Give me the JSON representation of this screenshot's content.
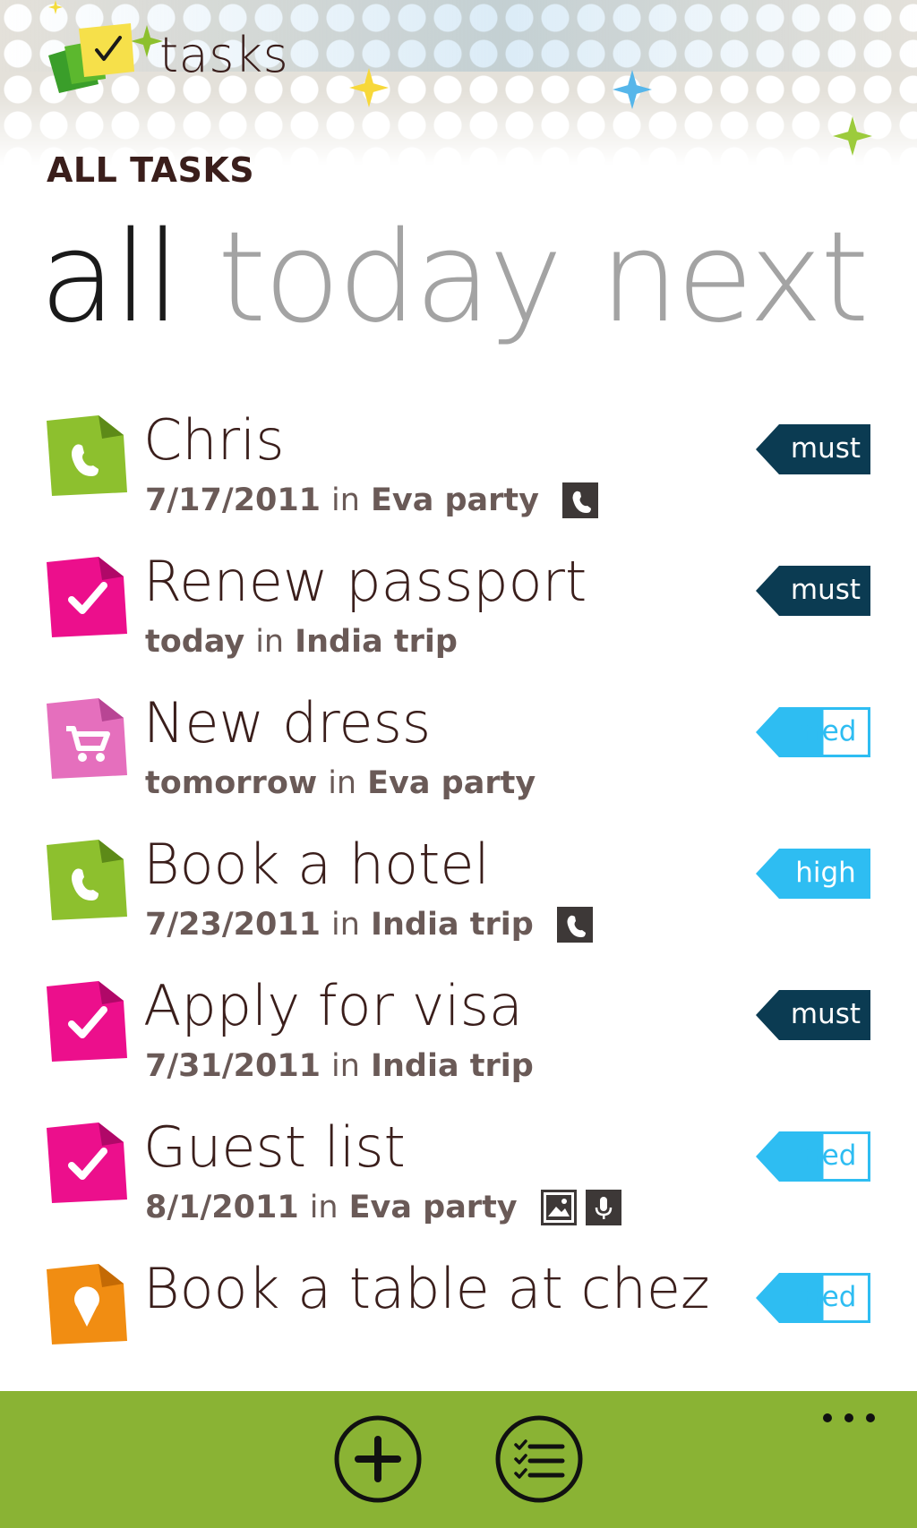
{
  "app": {
    "name": "tasks",
    "page_title": "ALL TASKS"
  },
  "pivot": {
    "items": [
      {
        "label": "all",
        "active": true
      },
      {
        "label": "today",
        "active": false
      },
      {
        "label": "next",
        "active": false
      }
    ]
  },
  "tasks": [
    {
      "title": "Chris",
      "due": "7/17/2011",
      "in_text": "in",
      "list": "Eva party",
      "icon": "phone-icon",
      "icon_color": "#8dc02e",
      "priority": "must",
      "attachments": [
        "phone-attachment-icon"
      ]
    },
    {
      "title": "Renew passport",
      "due": "today",
      "in_text": "in",
      "list": "India trip",
      "icon": "check-icon",
      "icon_color": "#ec0f8c",
      "priority": "must",
      "attachments": []
    },
    {
      "title": "New dress",
      "due": "tomorrow",
      "in_text": "in",
      "list": "Eva party",
      "icon": "cart-icon",
      "icon_color": "#e56fbd",
      "priority": "med",
      "attachments": []
    },
    {
      "title": "Book a hotel",
      "due": "7/23/2011",
      "in_text": "in",
      "list": "India trip",
      "icon": "phone-icon",
      "icon_color": "#8dc02e",
      "priority": "high",
      "attachments": [
        "phone-attachment-icon"
      ]
    },
    {
      "title": "Apply for visa",
      "due": "7/31/2011",
      "in_text": "in",
      "list": "India trip",
      "icon": "check-icon",
      "icon_color": "#ec0f8c",
      "priority": "must",
      "attachments": []
    },
    {
      "title": "Guest list",
      "due": "8/1/2011",
      "in_text": "in",
      "list": "Eva party",
      "icon": "check-icon",
      "icon_color": "#ec0f8c",
      "priority": "med",
      "attachments": [
        "image-attachment-icon",
        "mic-attachment-icon"
      ]
    },
    {
      "title": "Book a table at chez",
      "due": "",
      "in_text": "",
      "list": "",
      "icon": "location-icon",
      "icon_color": "#f18d12",
      "priority": "med",
      "attachments": []
    }
  ],
  "priority_styles": {
    "must": {
      "bg": "#0b3b52",
      "text": "#ffffff"
    },
    "high": {
      "bg": "#2ebdf2",
      "text": "#ffffff"
    },
    "med": {
      "bg": "#2ebdf2",
      "text": "#2ebdf2"
    }
  },
  "app_bar": {
    "color": "#8ab334",
    "buttons": [
      "add-icon",
      "list-icon",
      "more-icon"
    ]
  }
}
